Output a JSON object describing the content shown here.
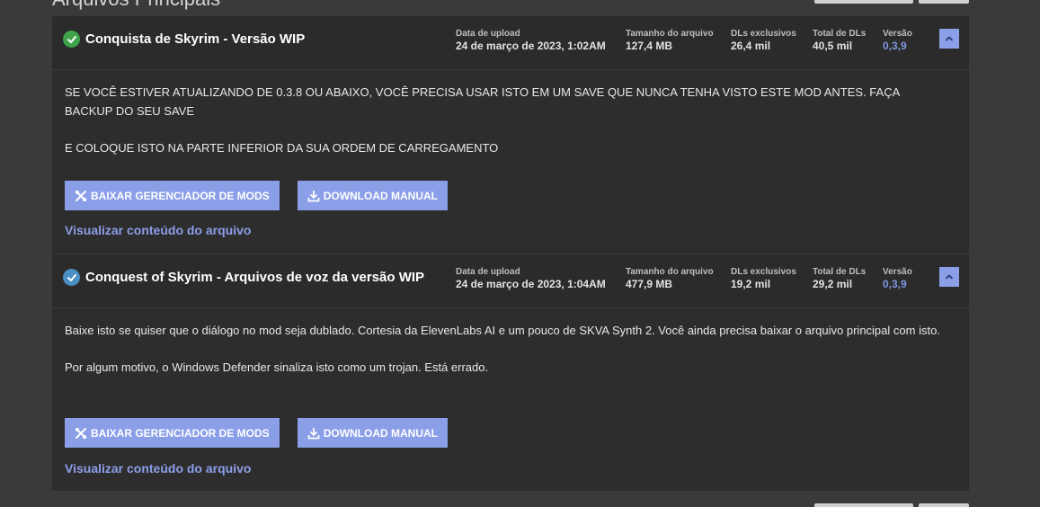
{
  "section_title": "Arquivos Principais",
  "stat_labels": {
    "upload_date": "Data de upload",
    "file_size": "Tamanho do arquivo",
    "unique_dls": "DLs exclusivos",
    "total_dls": "Total de DLs",
    "version": "Versão"
  },
  "buttons": {
    "mod_manager": "BAIXAR GERENCIADOR DE MODS",
    "manual": "DOWNLOAD MANUAL",
    "view_contents": "Visualizar conteúdo do arquivo"
  },
  "colors": {
    "accent": "#8b9ee8",
    "status_green": "#3fa34d",
    "status_blue": "#4a8fc4",
    "panel_bg": "#2d2d2d"
  },
  "files": [
    {
      "title": "Conquista de Skyrim - Versão WIP",
      "status_icon": "check-circle-green-icon",
      "upload_date": "24 de março de 2023, 1:02AM",
      "file_size": "127,4 MB",
      "unique_dls": "26,4 mil",
      "total_dls": "40,5 mil",
      "version": "0,3,9",
      "description": [
        "SE VOCÊ ESTIVER ATUALIZANDO DE 0.3.8 OU ABAIXO, VOCÊ PRECISA USAR ISTO EM UM SAVE QUE NUNCA TENHA VISTO ESTE MOD ANTES. FAÇA BACKUP DO SEU SAVE",
        "E COLOQUE ISTO NA PARTE INFERIOR DA SUA ORDEM DE CARREGAMENTO"
      ]
    },
    {
      "title": "Conquest of Skyrim - Arquivos de voz da versão WIP",
      "status_icon": "check-circle-blue-icon",
      "upload_date": "24 de março de 2023, 1:04AM",
      "file_size": "477,9 MB",
      "unique_dls": "19,2 mil",
      "total_dls": "29,2 mil",
      "version": "0,3,9",
      "description": [
        "Baixe isto se quiser que o diálogo no mod seja dublado. Cortesia da ElevenLabs AI e um pouco de SKVA Synth 2. Você ainda precisa baixar o arquivo principal com isto.",
        "Por algum motivo, o Windows Defender sinaliza isto como um trojan. Está errado."
      ]
    }
  ]
}
